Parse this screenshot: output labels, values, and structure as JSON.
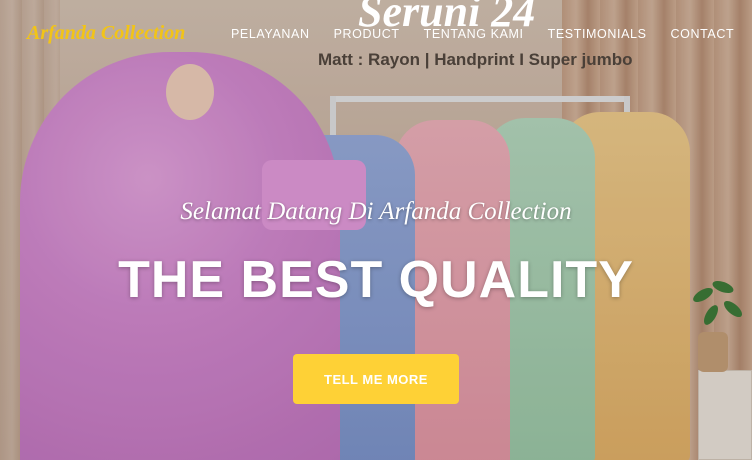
{
  "header": {
    "logo": "Arfanda Collection",
    "nav": [
      {
        "label": "PELAYANAN"
      },
      {
        "label": "PRODUCT"
      },
      {
        "label": "TENTANG KAMI"
      },
      {
        "label": "TESTIMONIALS"
      },
      {
        "label": "CONTACT"
      }
    ]
  },
  "banner": {
    "product_name": "Seruni 24",
    "product_spec": "Matt : Rayon | Handprint I Super jumbo"
  },
  "hero": {
    "welcome": "Selamat Datang Di Arfanda Collection",
    "headline": "THE BEST QUALITY",
    "cta_label": "TELL ME MORE"
  },
  "colors": {
    "logo": "#f2c417",
    "cta_background": "#fed136",
    "nav_text": "#ffffff"
  }
}
